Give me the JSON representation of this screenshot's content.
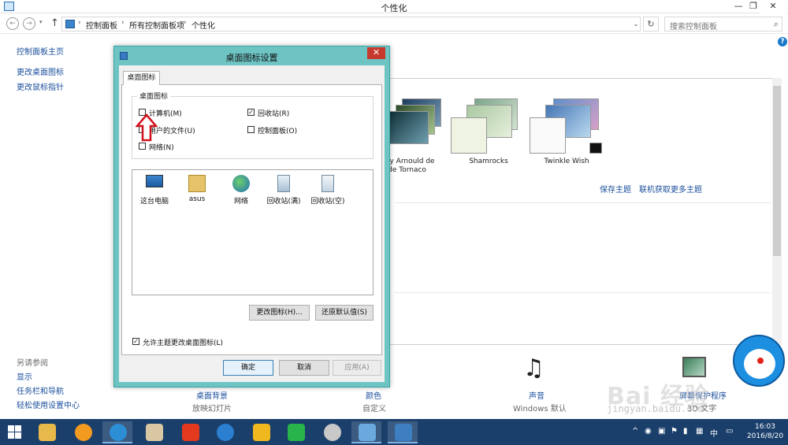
{
  "window": {
    "title": "个性化",
    "minimize": "—",
    "restore": "❐",
    "close": "✕"
  },
  "addressbar": {
    "crumbs": [
      "控制面板",
      "所有控制面板项",
      "个性化"
    ],
    "separator": "›",
    "search_placeholder": "搜索控制面板",
    "refresh": "↻",
    "dropdown": "⌄"
  },
  "nav": {
    "back": "←",
    "forward": "→",
    "up": "↑"
  },
  "help": "?",
  "left_nav": {
    "home": "控制面板主页",
    "links": [
      "更改桌面图标",
      "更改鼠标指针"
    ],
    "see_also_title": "另请参阅",
    "see_also": [
      "显示",
      "任务栏和导航",
      "轻松使用设置中心"
    ]
  },
  "themes": [
    {
      "label_lines": [
        "ons by Arnould de",
        "esta de Tornaco"
      ]
    },
    {
      "label_lines": [
        "Shamrocks"
      ]
    },
    {
      "label_lines": [
        "Twinkle Wish"
      ]
    }
  ],
  "panel_links": {
    "save_theme": "保存主题",
    "get_more": "联机获取更多主题"
  },
  "bottom_features": [
    {
      "label": "桌面背景",
      "sub": "放映幻灯片"
    },
    {
      "label": "颜色",
      "sub": "自定义"
    },
    {
      "label": "声音",
      "sub": "Windows 默认"
    },
    {
      "label": "屏幕保护程序",
      "sub": "3D 文字"
    }
  ],
  "dialog": {
    "title": "桌面图标设置",
    "close": "✕",
    "tab": "桌面图标",
    "group_title": "桌面图标",
    "checkboxes": [
      {
        "label": "计算机(M)",
        "checked": false,
        "mark": ""
      },
      {
        "label": "回收站(R)",
        "checked": true,
        "mark": "✓"
      },
      {
        "label": "用户的文件(U)",
        "checked": false,
        "mark": ""
      },
      {
        "label": "控制面板(O)",
        "checked": false,
        "mark": ""
      },
      {
        "label": "网络(N)",
        "checked": false,
        "mark": ""
      }
    ],
    "icons": [
      "这台电脑",
      "asus",
      "网络",
      "回收站(满)",
      "回收站(空)"
    ],
    "change_icon": "更改图标(H)...",
    "restore_default": "还原默认值(S)",
    "allow_themes": "允许主题更改桌面图标(L)",
    "allow_themes_checked": true,
    "allow_mark": "✓",
    "ok": "确定",
    "cancel": "取消",
    "apply": "应用(A)"
  },
  "taskbar": {
    "time": "16:03",
    "date": "2016/8/20",
    "ime": "中",
    "tray_caret": "^"
  },
  "watermark": {
    "line1": "Bai 经验",
    "line2": "jingyan.baidu.com"
  }
}
